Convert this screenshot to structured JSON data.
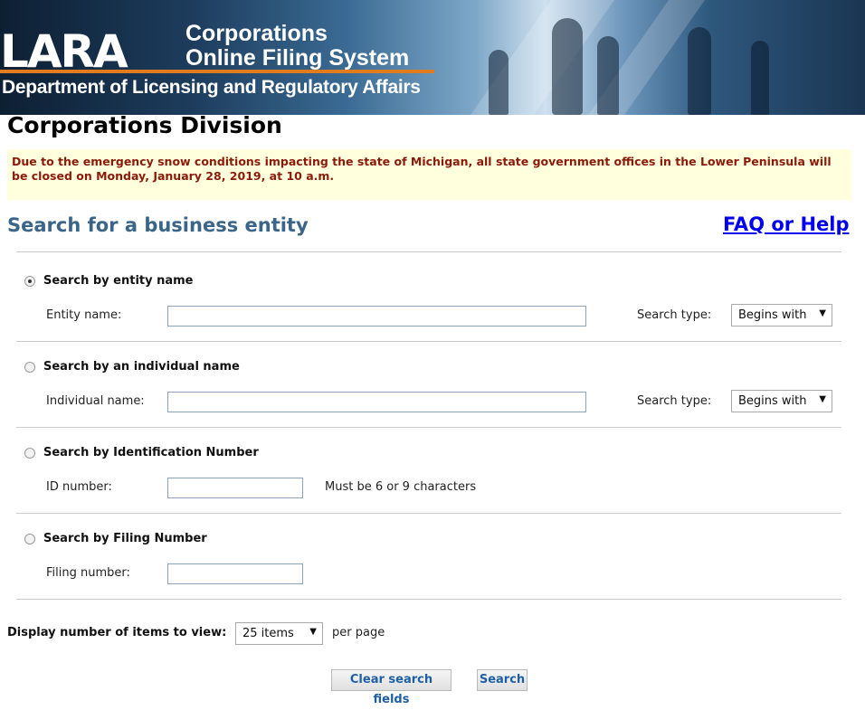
{
  "header": {
    "logo_text": "LARA",
    "system_title_line1": "Corporations",
    "system_title_line2": "Online Filing System",
    "department": "Department of Licensing and Regulatory Affairs"
  },
  "page_title": "Corporations Division",
  "notice": "Due to the emergency snow conditions impacting the state of Michigan, all state government offices in the Lower Peninsula will be closed on Monday, January 28, 2019, at 10 a.m.",
  "search": {
    "heading": "Search for a business entity",
    "help_link": "FAQ or Help",
    "sections": {
      "entity": {
        "title": "Search by entity name",
        "field_label": "Entity name:",
        "value": "",
        "search_type_label": "Search type:",
        "search_type_value": "Begins with",
        "selected": true
      },
      "individual": {
        "title": "Search by an individual name",
        "field_label": "Individual name:",
        "value": "",
        "search_type_label": "Search type:",
        "search_type_value": "Begins with",
        "selected": false
      },
      "id": {
        "title": "Search by Identification Number",
        "field_label": "ID number:",
        "value": "",
        "hint": "Must be 6 or 9 characters",
        "selected": false
      },
      "filing": {
        "title": "Search by Filing Number",
        "field_label": "Filing number:",
        "value": "",
        "selected": false
      }
    }
  },
  "display": {
    "label": "Display number of items to view:",
    "items_value": "25 items",
    "per_page": "per page"
  },
  "buttons": {
    "clear": "Clear search fields",
    "search": "Search"
  },
  "colors": {
    "heading_blue": "#3a6589",
    "notice_bg": "#ffffdd",
    "notice_text": "#8b1a0a",
    "link": "#0000ee",
    "button_text": "#1f5fa6",
    "accent_orange": "#e07b1f"
  },
  "icons": {
    "select_arrow": "dropdown-arrow-icon",
    "radio": "radio-icon"
  }
}
